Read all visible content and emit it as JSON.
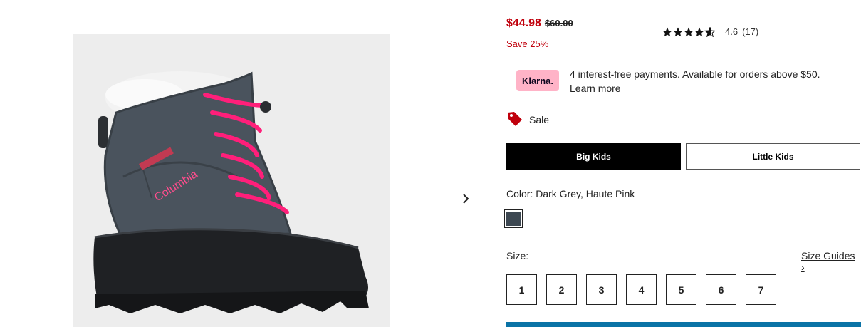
{
  "product": {
    "sale_price": "$44.98",
    "original_price": "$60.00",
    "save_text": "Save 25%",
    "rating": {
      "value": "4.6",
      "count": "(17)",
      "stars": 4.6
    },
    "klarna": {
      "badge": "Klarna.",
      "message": "4 interest-free payments. Available for orders above $50.",
      "link": "Learn more"
    },
    "sale_badge": "Sale",
    "size_groups": [
      {
        "label": "Big Kids",
        "selected": true
      },
      {
        "label": "Little Kids",
        "selected": false
      }
    ],
    "color": {
      "label": "Color: Dark Grey, Haute Pink",
      "swatch_color": "#3d4852"
    },
    "size": {
      "label": "Size:",
      "guides_link": "Size Guides ›",
      "options": [
        "1",
        "2",
        "3",
        "4",
        "5",
        "6",
        "7"
      ]
    },
    "image": {
      "brand_on_boot": "Columbia"
    }
  },
  "colors": {
    "sale_red": "#c0000c",
    "klarna_pink": "#ffb3c7",
    "primary_blue": "#0a73a6"
  }
}
